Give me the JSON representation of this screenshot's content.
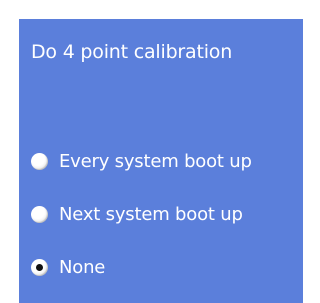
{
  "calibration": {
    "title": "Do 4 point calibration",
    "options": [
      {
        "label": "Every system boot up",
        "selected": false
      },
      {
        "label": "Next system boot up",
        "selected": false
      },
      {
        "label": "None",
        "selected": true
      }
    ],
    "selected_value": "None",
    "colors": {
      "panel_background": "#5b7fdb",
      "text": "#ffffff",
      "radio_fill": "#ffffff",
      "radio_dot": "#111111"
    }
  }
}
